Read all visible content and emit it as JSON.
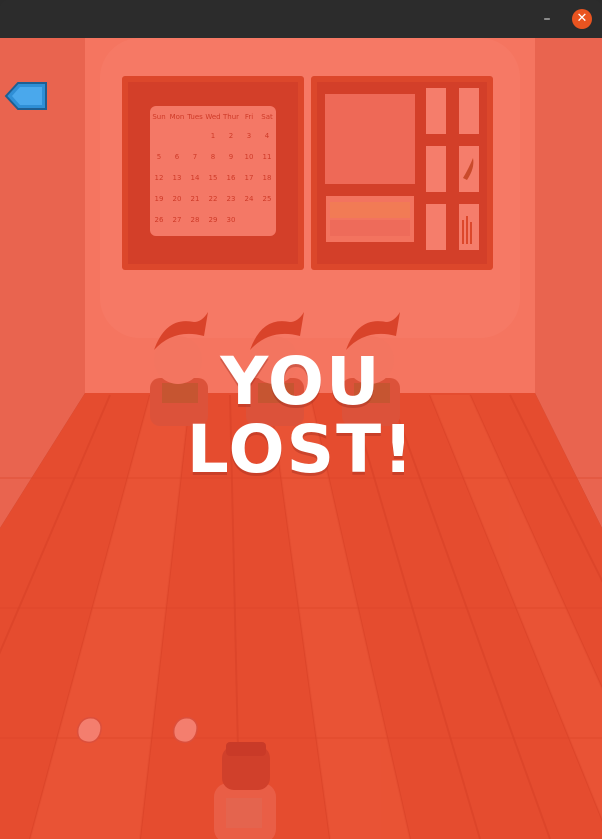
{
  "window": {
    "minimize_label": "–",
    "close_label": "✕",
    "close_color": "#e95420"
  },
  "calendar": {
    "headers": [
      "Sun",
      "Mon",
      "Tues",
      "Wed",
      "Thur",
      "Fri",
      "Sat"
    ],
    "rows": [
      [
        "",
        "",
        "",
        "1",
        "2",
        "3",
        "4"
      ],
      [
        "5",
        "6",
        "7",
        "8",
        "9",
        "10",
        "11"
      ],
      [
        "12",
        "13",
        "14",
        "15",
        "16",
        "17",
        "18"
      ],
      [
        "19",
        "20",
        "21",
        "22",
        "23",
        "24",
        "25"
      ],
      [
        "26",
        "27",
        "28",
        "29",
        "30",
        "",
        ""
      ]
    ]
  },
  "message": {
    "line1": "YOU",
    "line2": "LOST!"
  },
  "icons": {
    "back": "back-arrow-icon",
    "brain": "brain-icon"
  },
  "colors": {
    "overlay": "#f5593c",
    "floor": "#d95a36",
    "wall": "#f08a6e",
    "board_frame": "#c8502e",
    "back_button": "#2f8fd6"
  }
}
